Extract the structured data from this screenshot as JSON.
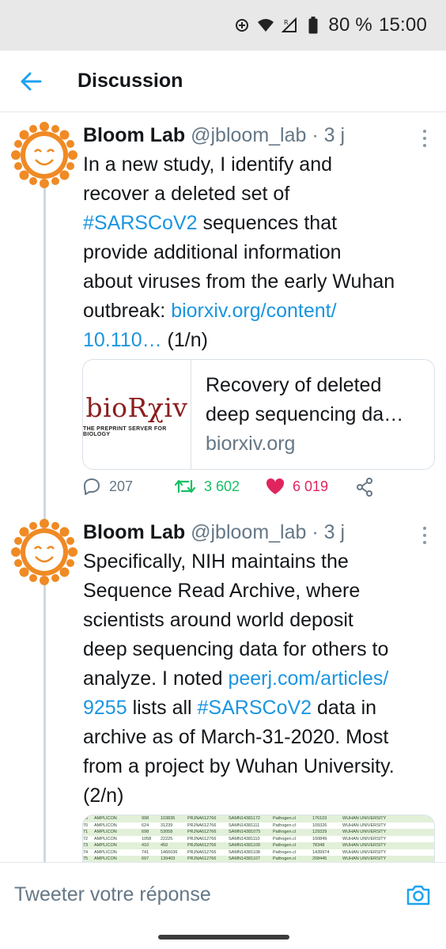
{
  "status_bar": {
    "battery": "80 %",
    "time": "15:00",
    "icons": [
      "location-target-icon",
      "wifi-icon",
      "cellular-r-icon",
      "battery-icon"
    ]
  },
  "header": {
    "title": "Discussion",
    "back_icon": "arrow-left-icon",
    "accent_color": "#1da1f2"
  },
  "tweets": [
    {
      "author_name": "Bloom Lab",
      "handle": "@jbloom_lab",
      "separator": "·",
      "time": "3 j",
      "text_lines": [
        [
          {
            "t": "In a new study, I identify and"
          }
        ],
        [
          {
            "t": "recover a deleted set of"
          }
        ],
        [
          {
            "t": "#SARSCoV2",
            "link": true
          },
          {
            "t": " sequences that"
          }
        ],
        [
          {
            "t": "provide additional information"
          }
        ],
        [
          {
            "t": "about viruses from the early Wuhan"
          }
        ],
        [
          {
            "t": "outbreak: "
          },
          {
            "t": "biorxiv.org/content/",
            "link": true
          }
        ],
        [
          {
            "t": "10.110…",
            "link": true
          },
          {
            "t": " (1/n)"
          }
        ]
      ],
      "card": {
        "logo_text": "bioRχiv",
        "logo_tagline": "THE PREPRINT SERVER FOR BIOLOGY",
        "title_lines": [
          "Recovery of deleted",
          "deep sequencing da…"
        ],
        "domain": "biorxiv.org"
      },
      "actions": {
        "replies": "207",
        "retweets": "3 602",
        "likes": "6 019"
      }
    },
    {
      "author_name": "Bloom Lab",
      "handle": "@jbloom_lab",
      "separator": "·",
      "time": "3 j",
      "text_lines": [
        [
          {
            "t": "Specifically, NIH maintains the"
          }
        ],
        [
          {
            "t": "Sequence Read Archive, where"
          }
        ],
        [
          {
            "t": "scientists around world deposit"
          }
        ],
        [
          {
            "t": "deep sequencing data for others to"
          }
        ],
        [
          {
            "t": "analyze. I noted "
          },
          {
            "t": "peerj.com/articles/",
            "link": true
          }
        ],
        [
          {
            "t": "9255",
            "link": true
          },
          {
            "t": " lists all "
          },
          {
            "t": "#SARSCoV2",
            "link": true
          },
          {
            "t": " data in"
          }
        ],
        [
          {
            "t": "archive as of March-31-2020. Most"
          }
        ],
        [
          {
            "t": "from a project by Wuhan University."
          }
        ],
        [
          {
            "t": "(2/n)"
          }
        ]
      ],
      "image_rows": [
        [
          "70",
          "AMPLICON",
          "998",
          "103835",
          "PRJNA612766",
          "SAMN14381172",
          "Pathogen.cl",
          "176103",
          "WUHAN UNIVERSITY"
        ],
        [
          "70",
          "AMPLICON",
          "624",
          "31239",
          "PRJNA612766",
          "SAMN14381111",
          "Pathogen.cl",
          "109326",
          "WUHAN UNIVERSITY"
        ],
        [
          "71",
          "AMPLICON",
          "698",
          "53058",
          "PRJNA612766",
          "SAMN14381075",
          "Pathogen.cl",
          "129329",
          "WUHAN UNIVERSITY"
        ],
        [
          "72",
          "AMPLICON",
          "1058",
          "22225",
          "PRJNA612766",
          "SAMN14381110",
          "Pathogen.cl",
          "100849",
          "WUHAN UNIVERSITY"
        ],
        [
          "73",
          "AMPLICON",
          "410",
          "450",
          "PRJNA612766",
          "SAMN14381109",
          "Pathogen.cl",
          "78348",
          "WUHAN UNIVERSITY"
        ],
        [
          "74",
          "AMPLICON",
          "741",
          "1466036",
          "PRJNA612766",
          "SAMN14381108",
          "Pathogen.cl",
          "1439974",
          "WUHAN UNIVERSITY"
        ],
        [
          "75",
          "AMPLICON",
          "697",
          "139403",
          "PRJNA612766",
          "SAMN14381107",
          "Pathogen.cl",
          "208445",
          "WUHAN UNIVERSITY"
        ]
      ]
    }
  ],
  "reply_bar": {
    "placeholder": "Tweeter votre réponse",
    "camera_icon": "camera-icon"
  },
  "colors": {
    "link": "#1b95e0",
    "retweet": "#17bf63",
    "like": "#e0245e",
    "muted": "#657786"
  }
}
